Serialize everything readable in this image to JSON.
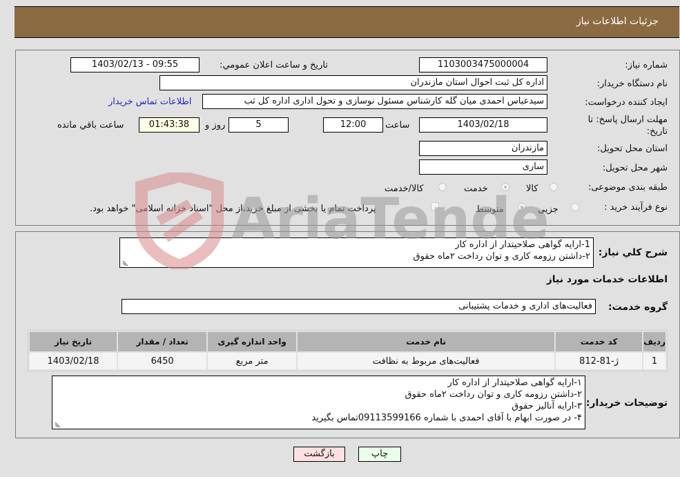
{
  "header": {
    "title": "جزئیات اطلاعات نیاز"
  },
  "fields": {
    "need_number_label": "شماره نیاز:",
    "need_number": "1103003475000004",
    "announce_label": "تاريخ و ساعت اعلان عمومي:",
    "announce_value": "1403/02/13 - 09:55",
    "buyer_org_label": "نام دستگاه خریدار:",
    "buyer_org": "اداره کل ثبت احوال استان مازندران",
    "creator_label": "ایجاد کننده درخواست:",
    "creator": "سیدعباس احمدی میان گله کارشناس مسئول نوسازی و تحول اداری اداره کل ثب",
    "contact_link": "اطلاعات تماس خریدار",
    "deadline_label_1": "مهلت ارسال پاسخ: تا",
    "deadline_label_2": "تاریخ:",
    "deadline_date": "1403/02/18",
    "time_label": "ساعت",
    "deadline_time": "12:00",
    "days_value": "5",
    "days_label": "روز و",
    "remaining_time": "01:43:38",
    "remaining_label": "ساعت باقي مانده",
    "province_label": "استان محل تحویل:",
    "province": "مازندران",
    "city_label": "شهر محل تحویل:",
    "city": "ساری",
    "category_label": "طبقه بندی موضوعی:",
    "category_options": [
      {
        "label": "کالا",
        "selected": false
      },
      {
        "label": "خدمت",
        "selected": true
      },
      {
        "label": "کالا/خدمت",
        "selected": false
      }
    ],
    "process_label": "نوع فرآیند خرید :",
    "process_options": [
      {
        "label": "جزيي",
        "selected": false
      },
      {
        "label": "متوسط",
        "selected": true
      }
    ],
    "treasury_checkbox_label": "پرداخت تمام یا بخشی از مبلغ خرید،از محل \"اسناد خزانه اسلامی\" خواهد بود.",
    "treasury_checked": false
  },
  "description": {
    "label": "شرح کلي نياز:",
    "lines": [
      "1-ارایه گواهی صلاحیتدار از اداره کار",
      "۲-داشتن رزومه کاری و توان رداخت ۲ماه حقوق"
    ]
  },
  "services": {
    "section_title": "اطلاعات خدمات مورد نیاز",
    "group_label": "گروه خدمت:",
    "group_value": "فعالیت‌های اداری و خدمات پشتیبانی",
    "table": {
      "headers": [
        "ردیف",
        "کد خدمت",
        "نام خدمت",
        "واحد اندازه گیری",
        "تعداد / مقدار",
        "تاریخ نیاز"
      ],
      "rows": [
        [
          "1",
          "ژ-81-812",
          "فعالیت‌های مربوط به نظافت",
          "متر مربع",
          "6450",
          "1403/02/18"
        ]
      ]
    }
  },
  "buyer_notes": {
    "label": "توضیحات خریدار:",
    "lines": [
      "۱-ارایه گواهی صلاحیتدار از اداره کار",
      "۲-داشتن رزومه کاری و توان رداخت ۲ماه حقوق",
      "۳-ارایه آنالیز حقوق",
      "۴- در صورت ابهام با آقای احمدی با شماره 09113599166تماس بگیرید"
    ]
  },
  "buttons": {
    "print": "چاپ",
    "back": "بازگشت"
  },
  "colors": {
    "header_bg": "#8b6b42",
    "print_bg": "#eaffea",
    "back_bg": "#ffe0e0",
    "link": "#2222cc"
  },
  "watermark": {
    "text": "AriaTender.neT"
  }
}
